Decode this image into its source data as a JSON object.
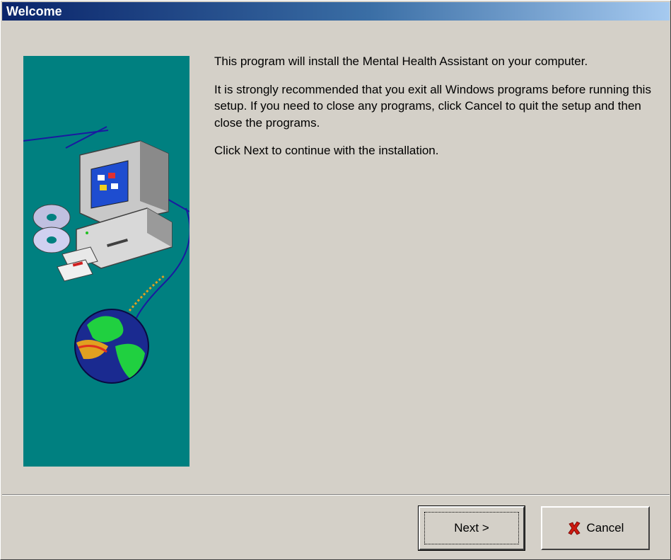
{
  "window": {
    "title": "Welcome"
  },
  "content": {
    "paragraph1": "This program will install the Mental Health Assistant on your computer.",
    "paragraph2": "It is strongly recommended that you exit all Windows programs before running this setup. If you need to close any programs, click Cancel to quit the setup and then close the programs.",
    "paragraph3": "Click Next to continue with the installation."
  },
  "buttons": {
    "next_label": "Next >",
    "cancel_label": "Cancel"
  },
  "icons": {
    "cancel": "red-x-icon",
    "illustration": "computer-globe-illustration"
  },
  "colors": {
    "titlebar_start": "#0a246a",
    "titlebar_end": "#a6caf0",
    "panel": "#008080",
    "face": "#d4d0c8",
    "cancel_x": "#cc1a10"
  }
}
